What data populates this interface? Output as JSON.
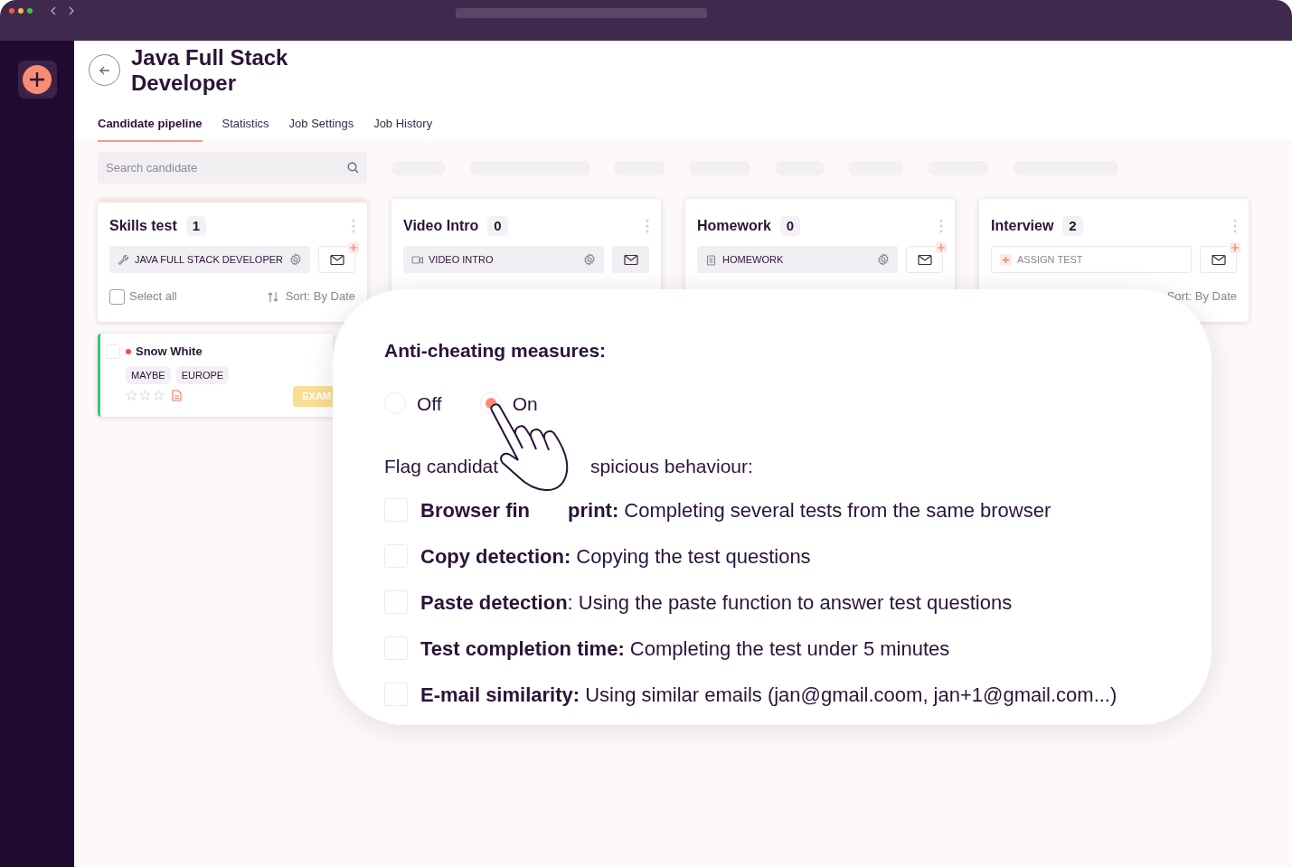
{
  "window": {
    "title": "Java Full Stack Developer"
  },
  "tabs": [
    {
      "label": "Candidate pipeline",
      "selected": true
    },
    {
      "label": "Statistics",
      "selected": false
    },
    {
      "label": "Job Settings",
      "selected": false
    },
    {
      "label": "Job History",
      "selected": false
    }
  ],
  "search": {
    "placeholder": "Search candidate"
  },
  "columns": [
    {
      "title": "Skills test",
      "count": "1",
      "highlighted": true,
      "test": {
        "kind": "test",
        "label": "JAVA FULL STACK DEVELOPER"
      },
      "mail_badge": true,
      "select_all": "Select all",
      "all_selected": false,
      "sort": "Sort: By Date",
      "candidates": [
        {
          "selected": false,
          "name": "Snow White",
          "tags": [
            "MAYBE",
            "EUROPE"
          ],
          "stars": 0,
          "action": "EXAM"
        }
      ]
    },
    {
      "title": "Video Intro",
      "count": "0",
      "highlighted": false,
      "test": {
        "kind": "video",
        "label": "VIDEO INTRO"
      },
      "mail_badge": false
    },
    {
      "title": "Homework",
      "count": "0",
      "highlighted": false,
      "test": {
        "kind": "homework",
        "label": "HOMEWORK"
      },
      "mail_badge": true
    },
    {
      "title": "Interview",
      "count": "2",
      "highlighted": false,
      "test": {
        "kind": "assign",
        "label": "ASSIGN TEST"
      },
      "mail_badge": true,
      "sort": "Sort: By Date"
    }
  ],
  "anti_cheating": {
    "title": "Anti-cheating measures:",
    "options": [
      {
        "label": "Off",
        "selected": false
      },
      {
        "label": "On",
        "selected": true
      }
    ],
    "prompt_parts": [
      "Flag candidat",
      "spicious behaviour:"
    ],
    "items": [
      {
        "parts": [
          "**Browser fin**",
          "**print:** Completing several tests from the same browser"
        ],
        "checked": false
      },
      {
        "parts": [
          "**Copy detection:** Copying the test questions"
        ],
        "checked": false
      },
      {
        "parts": [
          "**Paste detection**: Using the paste function to answer test questions"
        ],
        "checked": false
      },
      {
        "parts": [
          "**Test completion time:** Completing the test under 5 minutes"
        ],
        "checked": false
      },
      {
        "parts": [
          "**E-mail similarity:** Using similar emails (jan@gmail.coom, jan+1@gmail.com...)"
        ],
        "checked": false
      }
    ]
  }
}
